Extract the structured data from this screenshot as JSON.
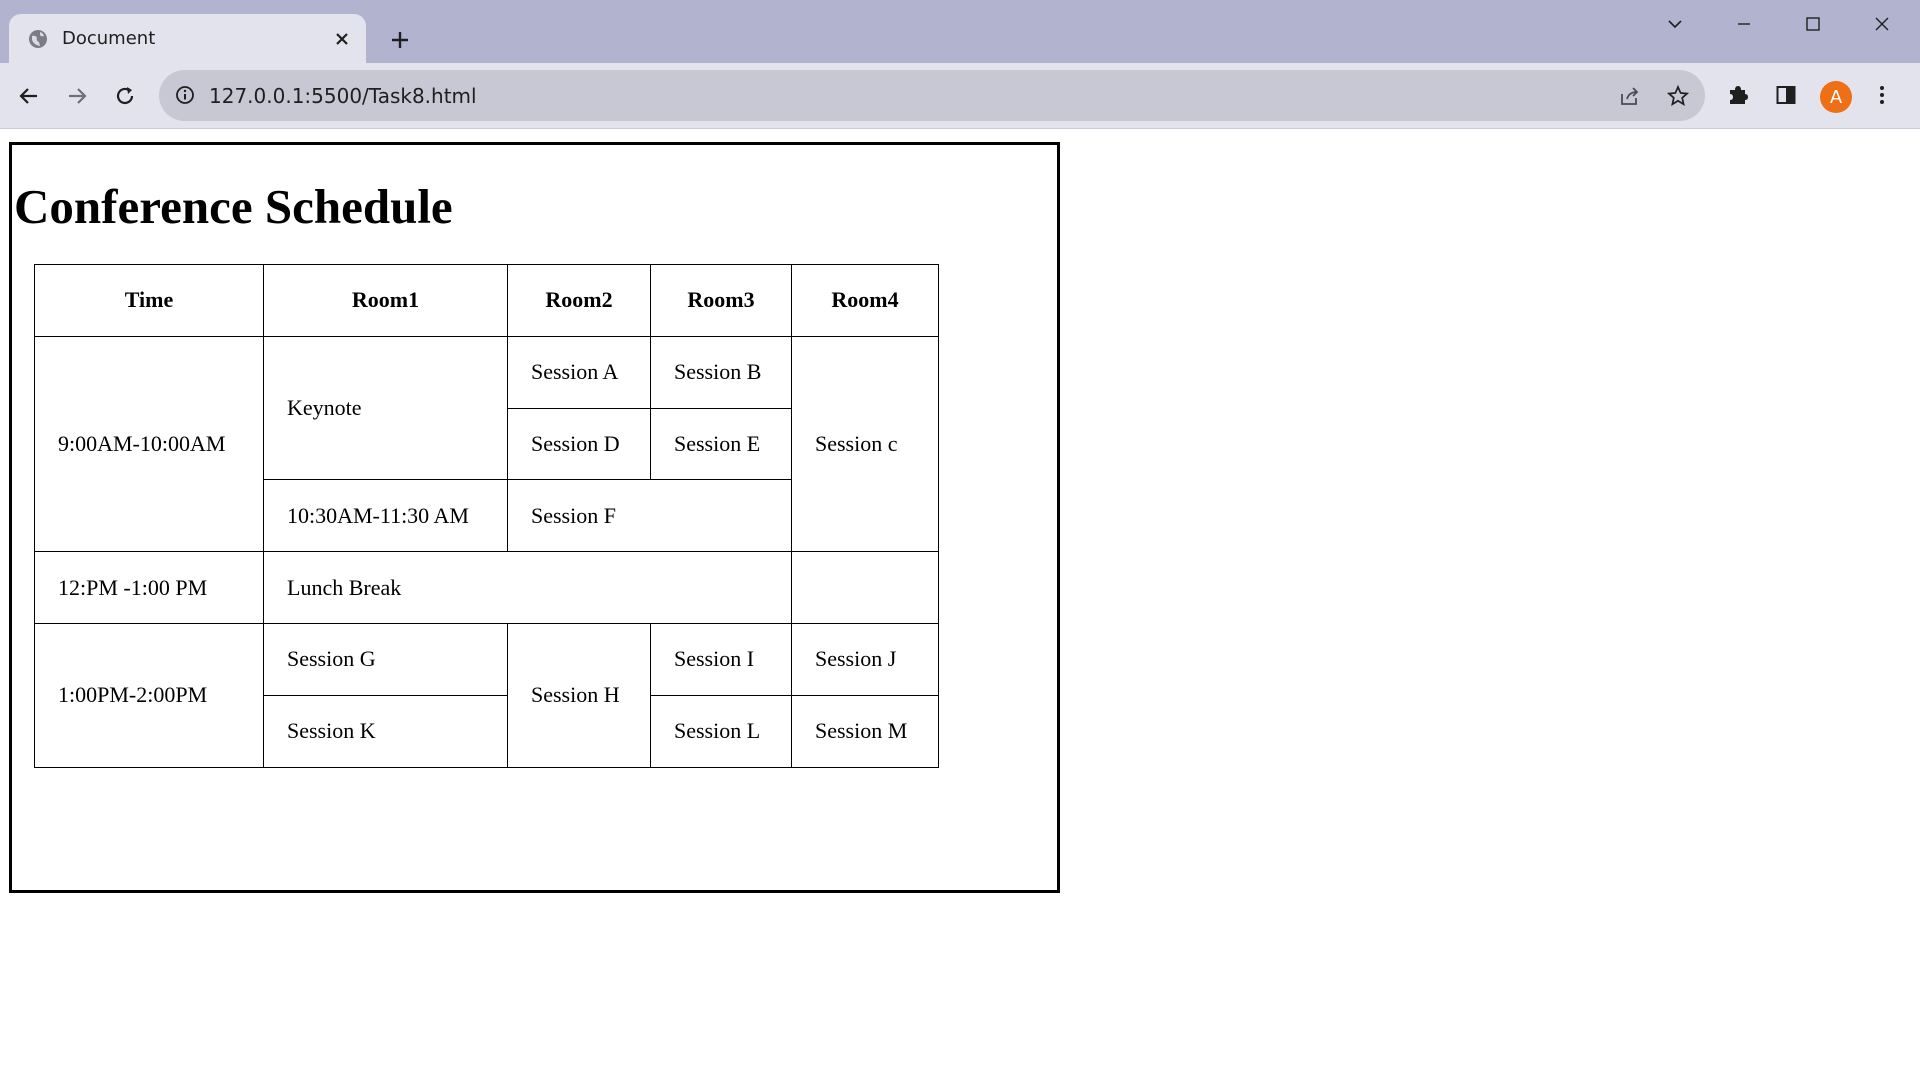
{
  "browser": {
    "tab_title": "Document",
    "url": "127.0.0.1:5500/Task8.html",
    "avatar_letter": "A",
    "avatar_color": "#ee6f16",
    "icons": {
      "favicon": "globe-icon",
      "tab_close": "close-icon",
      "new_tab": "plus-icon",
      "tab_search": "chevron-down-icon",
      "minimize": "minimize-icon",
      "maximize": "maximize-icon",
      "close": "close-icon",
      "back": "back-arrow-icon",
      "forward": "forward-arrow-icon",
      "reload": "reload-icon",
      "site_info": "info-icon",
      "share": "share-icon",
      "bookmark": "star-icon",
      "extensions": "puzzle-icon",
      "side_panel": "side-panel-icon",
      "menu": "kebab-menu-icon"
    }
  },
  "page": {
    "title": "Conference Schedule",
    "headers": [
      "Time",
      "Room1",
      "Room2",
      "Room3",
      "Room4"
    ],
    "cells": {
      "t1": "9:00AM-10:00AM",
      "keynote": "Keynote",
      "session_a": "Session A",
      "session_b": "Session B",
      "session_c": "Session c",
      "session_d": "Session D",
      "session_e": "Session E",
      "t2": "10:30AM-11:30 AM",
      "session_f": "Session F",
      "t3": "12:PM -1:00 PM",
      "lunch": "Lunch Break",
      "t4": "1:00PM-2:00PM",
      "session_g": "Session G",
      "session_h": "Session H",
      "session_i": "Session I",
      "session_j": "Session J",
      "session_k": "Session K",
      "session_l": "Session L",
      "session_m": "Session M"
    }
  }
}
